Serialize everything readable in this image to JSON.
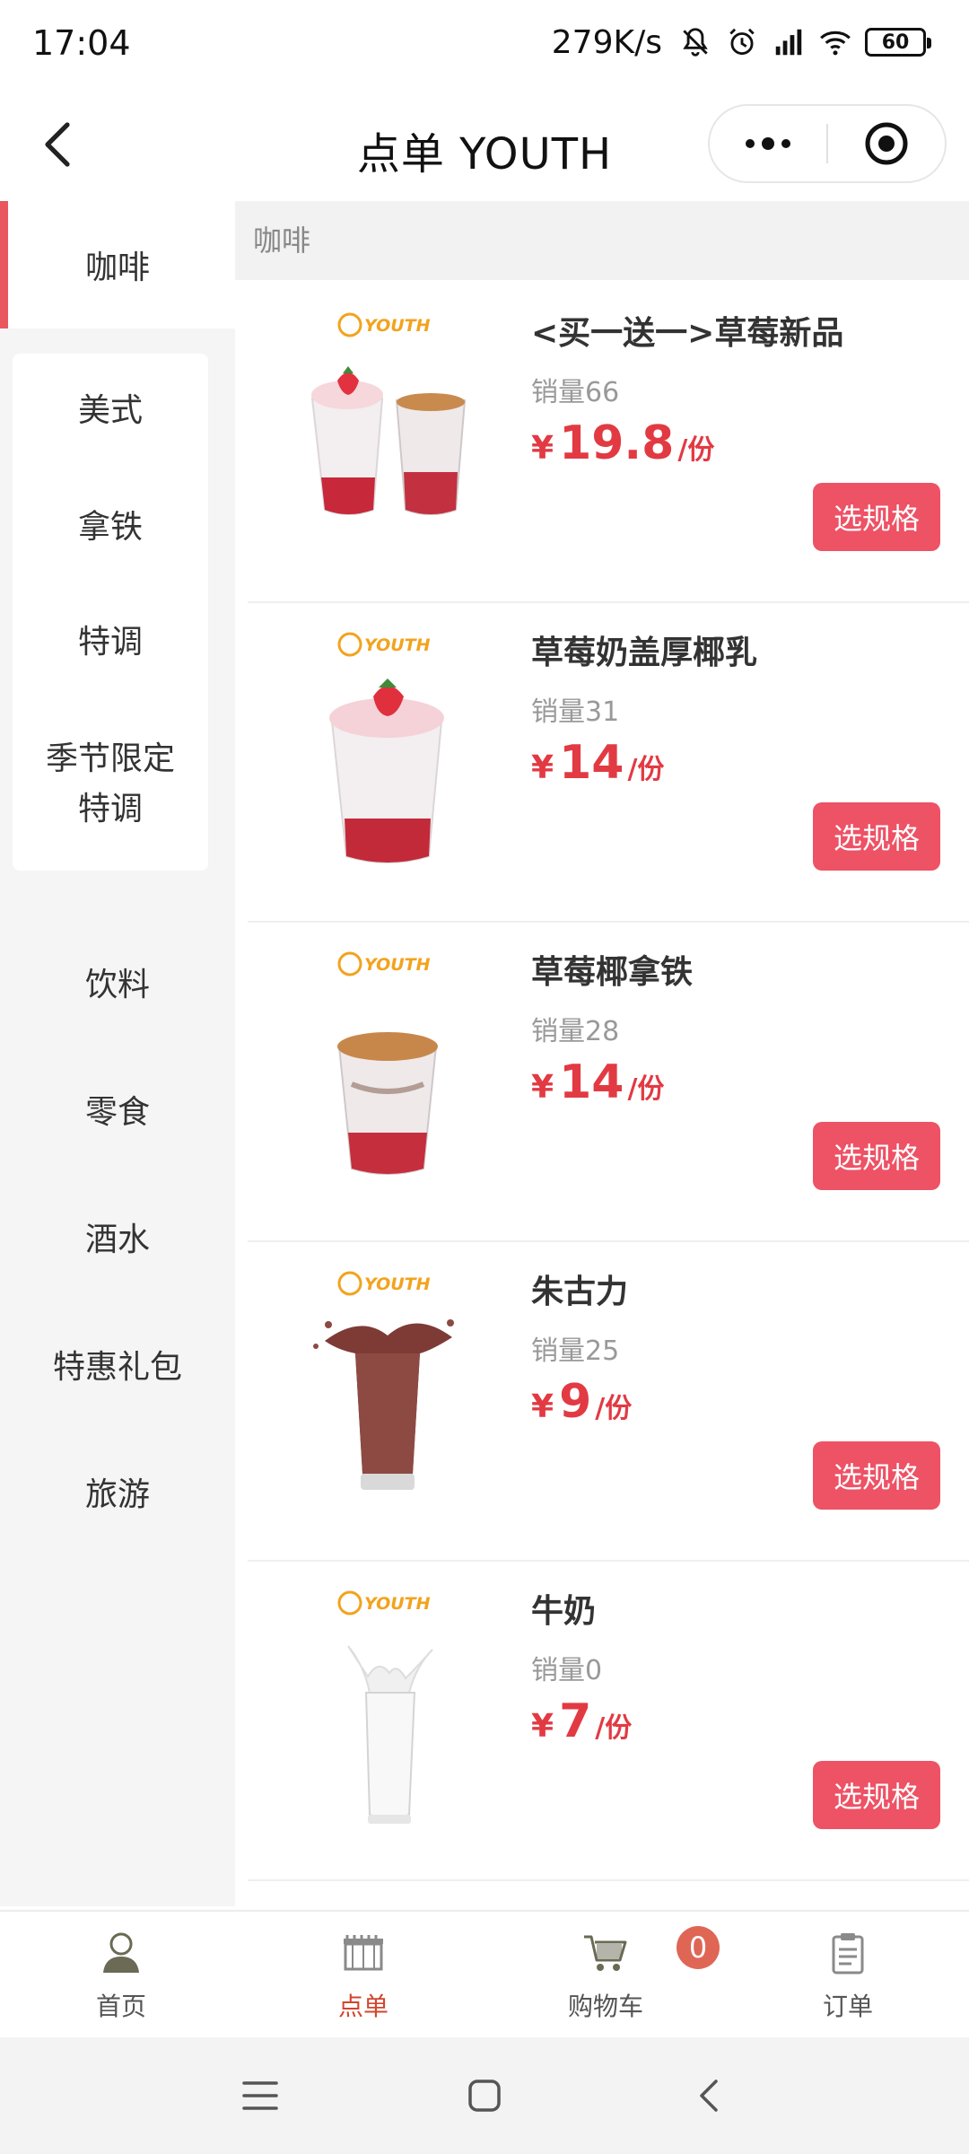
{
  "status_bar": {
    "time": "17:04",
    "speed": "279K/s",
    "battery": "60"
  },
  "header": {
    "title": "点单  YOUTH"
  },
  "sidebar": {
    "active_category": "咖啡",
    "subcategories": [
      "美式",
      "拿铁",
      "特调",
      "季节限定\n特调"
    ],
    "categories": [
      "饮料",
      "零食",
      "酒水",
      "特惠礼包",
      "旅游"
    ]
  },
  "content": {
    "section_title": "咖啡",
    "brand_mark": "YOUTH",
    "products": [
      {
        "name": "<买一送一>草莓新品",
        "sales": "销量66",
        "currency": "¥",
        "price": "19.8",
        "unit": "/份",
        "button": "选规格"
      },
      {
        "name": "草莓奶盖厚椰乳",
        "sales": "销量31",
        "currency": "¥",
        "price": "14",
        "unit": "/份",
        "button": "选规格"
      },
      {
        "name": "草莓椰拿铁",
        "sales": "销量28",
        "currency": "¥",
        "price": "14",
        "unit": "/份",
        "button": "选规格"
      },
      {
        "name": "朱古力",
        "sales": "销量25",
        "currency": "¥",
        "price": "9",
        "unit": "/份",
        "button": "选规格"
      },
      {
        "name": "牛奶",
        "sales": "销量0",
        "currency": "¥",
        "price": "7",
        "unit": "/份",
        "button": "选规格"
      }
    ]
  },
  "tabbar": {
    "tabs": [
      "首页",
      "点单",
      "购物车",
      "订单"
    ],
    "active_index": 1,
    "cart_count": "0"
  },
  "colors": {
    "accent": "#ee5265",
    "price": "#e23a43",
    "tab_active": "#d2452e",
    "badge": "#df6655",
    "sidebar_indicator": "#e9585f"
  }
}
